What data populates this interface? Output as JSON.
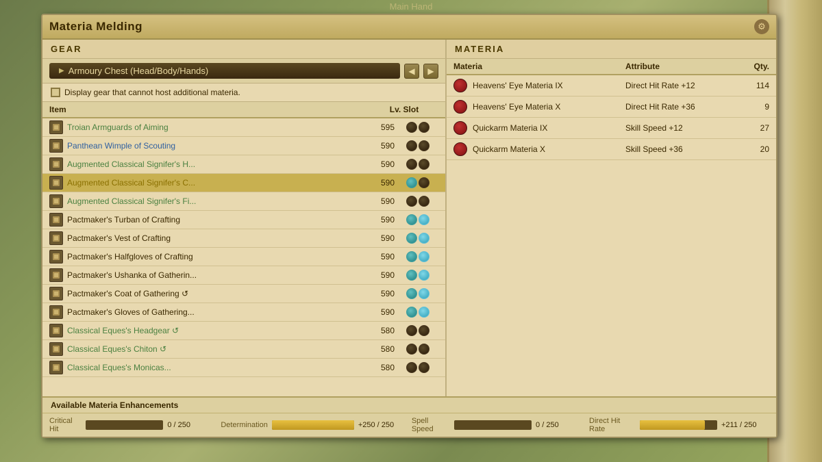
{
  "top_label": "Main Hand",
  "window": {
    "title": "Materia Melding",
    "gear_icon": "⚙"
  },
  "left_panel": {
    "section_header": "GEAR",
    "armoury": {
      "label": "Armoury Chest (Head/Body/Hands)",
      "prev_btn": "◀",
      "next_btn": "▶"
    },
    "checkbox_label": "Display gear that cannot host additional materia.",
    "table_headers": {
      "item": "Item",
      "lv_slot": "Lv. Slot"
    },
    "gear_items": [
      {
        "id": 1,
        "name": "Troian Armguards of Aiming",
        "lv": "595",
        "color": "green",
        "slot1": "dark",
        "slot2": "dark",
        "icon_type": "leather"
      },
      {
        "id": 2,
        "name": "Panthean Wimple of Scouting",
        "lv": "590",
        "color": "blue",
        "slot1": "dark",
        "slot2": "dark",
        "icon_type": "cloth"
      },
      {
        "id": 3,
        "name": "Augmented Classical Signifer's H...",
        "lv": "590",
        "color": "green",
        "slot1": "dark",
        "slot2": "dark",
        "icon_type": "cloth"
      },
      {
        "id": 4,
        "name": "Augmented Classical Signifer's C...",
        "lv": "590",
        "color": "yellow",
        "slot1": "teal",
        "slot2": "dark",
        "icon_type": "shirt",
        "selected": true
      },
      {
        "id": 5,
        "name": "Augmented Classical Signifer's Fi...",
        "lv": "590",
        "color": "green",
        "slot1": "dark",
        "slot2": "dark",
        "icon_type": "gloves"
      },
      {
        "id": 6,
        "name": "Pactmaker's Turban of Crafting",
        "lv": "590",
        "color": "white",
        "slot1": "teal",
        "slot2": "cyan",
        "icon_type": "turban"
      },
      {
        "id": 7,
        "name": "Pactmaker's Vest of Crafting",
        "lv": "590",
        "color": "white",
        "slot1": "teal",
        "slot2": "cyan",
        "icon_type": "vest"
      },
      {
        "id": 8,
        "name": "Pactmaker's Halfgloves of Crafting",
        "lv": "590",
        "color": "white",
        "slot1": "teal",
        "slot2": "cyan",
        "icon_type": "gloves"
      },
      {
        "id": 9,
        "name": "Pactmaker's Ushanka of Gatherin...",
        "lv": "590",
        "color": "white",
        "slot1": "teal",
        "slot2": "cyan",
        "icon_type": "hat"
      },
      {
        "id": 10,
        "name": "Pactmaker's Coat of Gathering ↺",
        "lv": "590",
        "color": "white",
        "slot1": "teal",
        "slot2": "cyan",
        "icon_type": "coat"
      },
      {
        "id": 11,
        "name": "Pactmaker's Gloves of Gathering...",
        "lv": "590",
        "color": "white",
        "slot1": "teal",
        "slot2": "cyan",
        "icon_type": "gloves"
      },
      {
        "id": 12,
        "name": "Classical Eques's Headgear ↺",
        "lv": "580",
        "color": "green",
        "slot1": "dark",
        "slot2": "dark",
        "icon_type": "helmet"
      },
      {
        "id": 13,
        "name": "Classical Eques's Chiton ↺",
        "lv": "580",
        "color": "green",
        "slot1": "dark",
        "slot2": "dark",
        "icon_type": "chest"
      },
      {
        "id": 14,
        "name": "Classical Eques's Monicas...",
        "lv": "580",
        "color": "green",
        "slot1": "dark",
        "slot2": "dark",
        "icon_type": "gloves"
      }
    ]
  },
  "right_panel": {
    "section_header": "MATERIA",
    "table_headers": {
      "materia": "Materia",
      "attribute": "Attribute",
      "qty": "Qty."
    },
    "materia_items": [
      {
        "id": 1,
        "name": "Heavens' Eye Materia IX",
        "attribute": "Direct Hit Rate +12",
        "qty": "114"
      },
      {
        "id": 2,
        "name": "Heavens' Eye Materia X",
        "attribute": "Direct Hit Rate +36",
        "qty": "9"
      },
      {
        "id": 3,
        "name": "Quickarm Materia IX",
        "attribute": "Skill Speed +12",
        "qty": "27"
      },
      {
        "id": 4,
        "name": "Quickarm Materia X",
        "attribute": "Skill Speed +36",
        "qty": "20"
      }
    ]
  },
  "bottom": {
    "section_label": "Available Materia Enhancements",
    "stats": [
      {
        "name": "Critical Hit",
        "value": "0 / 250",
        "fill_pct": 0,
        "color": "orange"
      },
      {
        "name": "Determination",
        "value": "+250 / 250",
        "fill_pct": 100,
        "color": "yellow"
      },
      {
        "name": "Spell Speed",
        "value": "0 / 250",
        "fill_pct": 0,
        "color": "orange"
      },
      {
        "name": "Direct Hit Rate",
        "value": "+211 / 250",
        "fill_pct": 84,
        "color": "yellow"
      }
    ]
  }
}
